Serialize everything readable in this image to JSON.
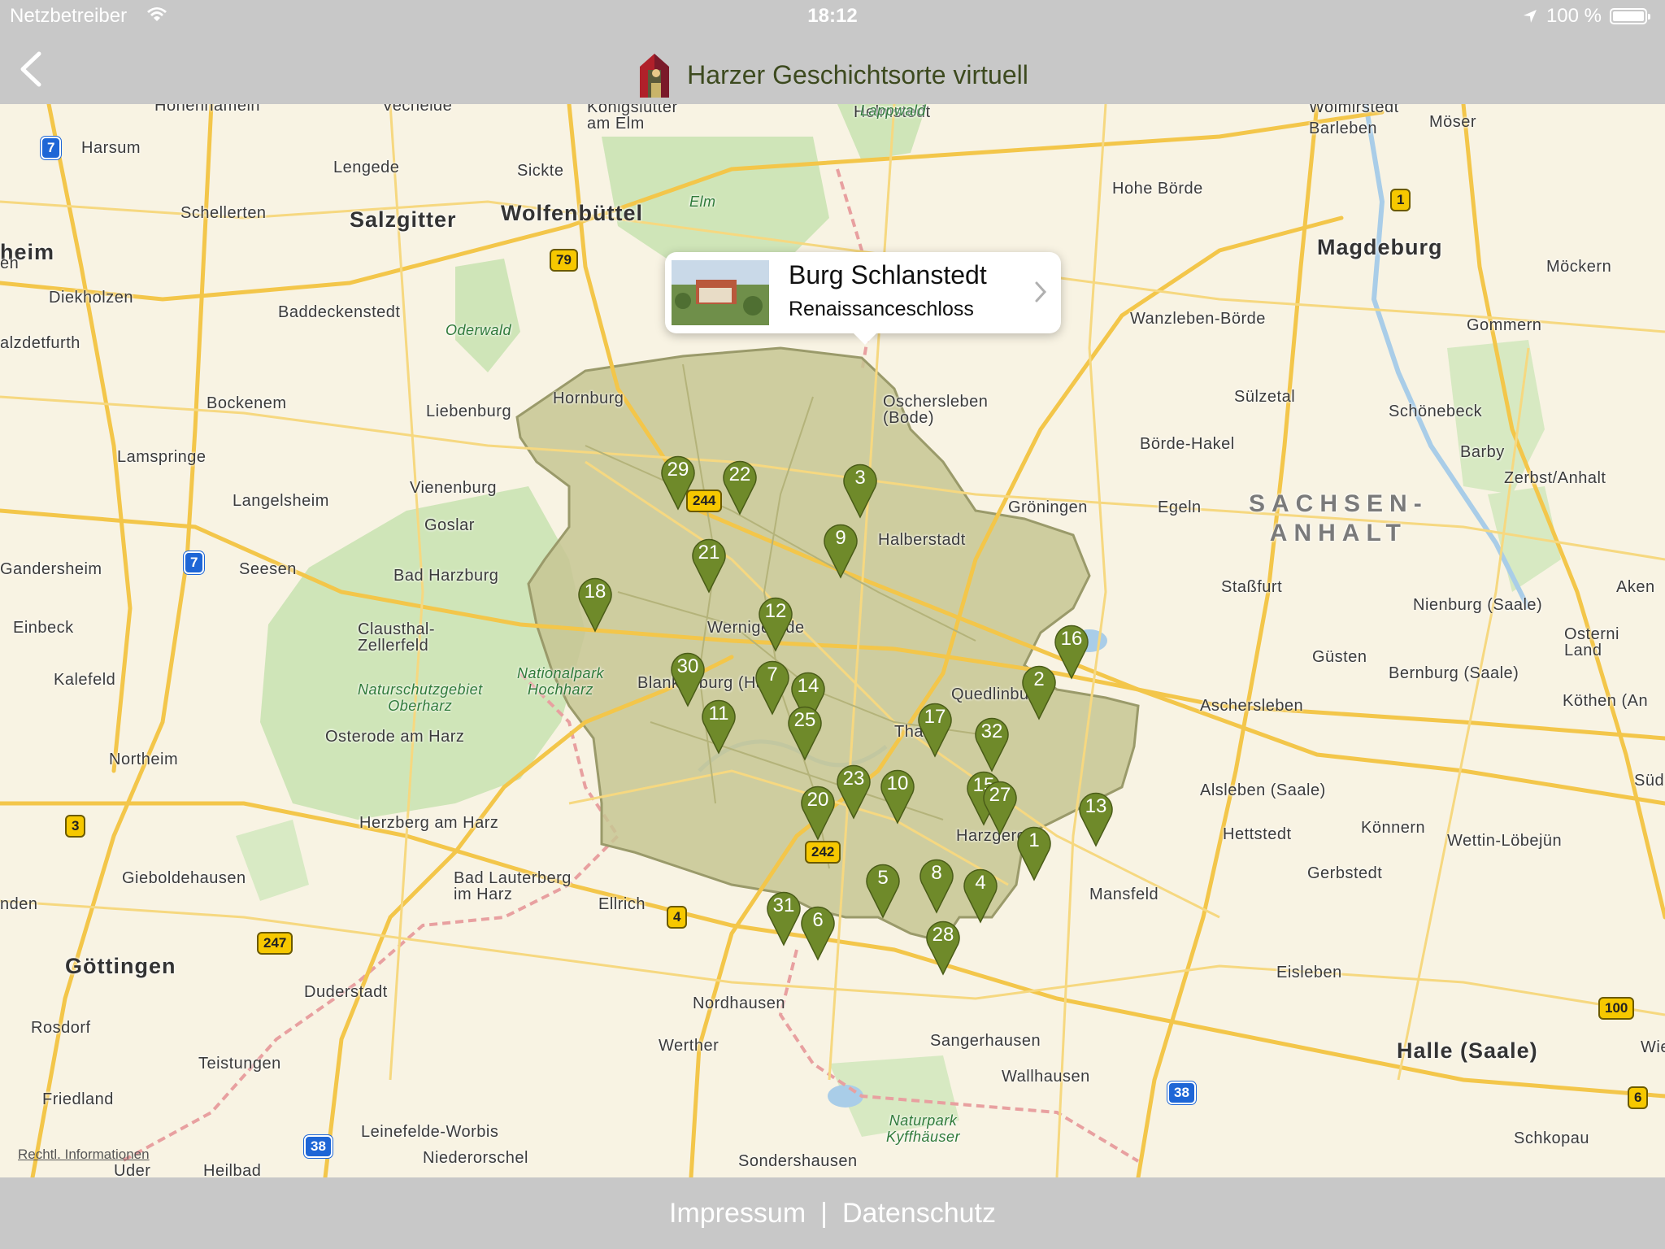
{
  "status": {
    "carrier": "Netzbetreiber",
    "time": "18:12",
    "battery": "100 %"
  },
  "nav": {
    "title": "Harzer Geschichtsorte virtuell",
    "back_icon": "chevron-left-icon"
  },
  "callout": {
    "title": "Burg Schlanstedt",
    "subtitle": "Renaissanceschloss"
  },
  "map": {
    "legal": "Rechtl. Informationen",
    "region": "SACHSEN-\nANHALT",
    "cities": [
      {
        "name": "Hohenhameln",
        "big": false
      },
      {
        "name": "Vechelde",
        "big": false
      },
      {
        "name": "Königslutter\nam Elm",
        "big": false
      },
      {
        "name": "Helmstedt",
        "big": false
      },
      {
        "name": "Wolmirstedt",
        "big": false
      },
      {
        "name": "Barleben",
        "big": false
      },
      {
        "name": "Möser",
        "big": false
      },
      {
        "name": "Harsum",
        "big": false
      },
      {
        "name": "Lengede",
        "big": false
      },
      {
        "name": "Sickte",
        "big": false
      },
      {
        "name": "Hohe Börde",
        "big": false
      },
      {
        "name": "Schellerten",
        "big": false
      },
      {
        "name": "Salzgitter",
        "big": true
      },
      {
        "name": "Wolfenbüttel",
        "big": true
      },
      {
        "name": "Magdeburg",
        "big": true
      },
      {
        "name": "heim",
        "big": true
      },
      {
        "name": "Diekholzen",
        "big": false
      },
      {
        "name": "Baddeckenstedt",
        "big": false
      },
      {
        "name": "Wanzleben-Börde",
        "big": false
      },
      {
        "name": "Möckern",
        "big": false
      },
      {
        "name": "alzdetfurth",
        "big": false
      },
      {
        "name": "Gommern",
        "big": false
      },
      {
        "name": "Hornburg",
        "big": false
      },
      {
        "name": "Bockenem",
        "big": false
      },
      {
        "name": "Liebenburg",
        "big": false
      },
      {
        "name": "Oschersleben\n(Bode)",
        "big": false
      },
      {
        "name": "Sülzetal",
        "big": false
      },
      {
        "name": "Schönebeck",
        "big": false
      },
      {
        "name": "Lamspringe",
        "big": false
      },
      {
        "name": "Börde-Hakel",
        "big": false
      },
      {
        "name": "Barby",
        "big": false
      },
      {
        "name": "Zerbst/Anhalt",
        "big": false
      },
      {
        "name": "Vienenburg",
        "big": false
      },
      {
        "name": "Langelsheim",
        "big": false
      },
      {
        "name": "Gröningen",
        "big": false
      },
      {
        "name": "Egeln",
        "big": false
      },
      {
        "name": "Goslar",
        "big": false
      },
      {
        "name": "Halberstadt",
        "big": false
      },
      {
        "name": "Gandersheim",
        "big": false
      },
      {
        "name": "Seesen",
        "big": false
      },
      {
        "name": "Bad Harzburg",
        "big": false
      },
      {
        "name": "Staßfurt",
        "big": false
      },
      {
        "name": "Aken",
        "big": false
      },
      {
        "name": "Einbeck",
        "big": false
      },
      {
        "name": "Clausthal-\nZellerfeld",
        "big": false
      },
      {
        "name": "Nienburg (Saale)",
        "big": false
      },
      {
        "name": "Osterni\nLand",
        "big": false
      },
      {
        "name": "Kalefeld",
        "big": false
      },
      {
        "name": "Güsten",
        "big": false
      },
      {
        "name": "Bernburg (Saale)",
        "big": false
      },
      {
        "name": "Blankenburg (Harz)",
        "big": false
      },
      {
        "name": "Quedlinburg",
        "big": false
      },
      {
        "name": "Köthen (An",
        "big": false
      },
      {
        "name": "Aschersleben",
        "big": false
      },
      {
        "name": "Osterode am Harz",
        "big": false
      },
      {
        "name": "Northeim",
        "big": false
      },
      {
        "name": "Thale",
        "big": false
      },
      {
        "name": "Alsleben (Saale)",
        "big": false
      },
      {
        "name": "Süd",
        "big": false
      },
      {
        "name": "Herzberg am Harz",
        "big": false
      },
      {
        "name": "Hettstedt",
        "big": false
      },
      {
        "name": "Könnern",
        "big": false
      },
      {
        "name": "Harzgerode",
        "big": false
      },
      {
        "name": "Wettin-Löbejün",
        "big": false
      },
      {
        "name": "Gieboldehausen",
        "big": false
      },
      {
        "name": "Bad Lauterberg\nim Harz",
        "big": false
      },
      {
        "name": "Gerbstedt",
        "big": false
      },
      {
        "name": "nden",
        "big": false
      },
      {
        "name": "Ellrich",
        "big": false
      },
      {
        "name": "Mansfeld",
        "big": false
      },
      {
        "name": "Göttingen",
        "big": true
      },
      {
        "name": "Eisleben",
        "big": false
      },
      {
        "name": "Duderstadt",
        "big": false
      },
      {
        "name": "Nordhausen",
        "big": false
      },
      {
        "name": "Rosdorf",
        "big": false
      },
      {
        "name": "Werther",
        "big": false
      },
      {
        "name": "Sangerhausen",
        "big": false
      },
      {
        "name": "Halle (Saale)",
        "big": true
      },
      {
        "name": "Wie",
        "big": false
      },
      {
        "name": "Teistungen",
        "big": false
      },
      {
        "name": "Wallhausen",
        "big": false
      },
      {
        "name": "Friedland",
        "big": false
      },
      {
        "name": "Leinefelde-Worbis",
        "big": false
      },
      {
        "name": "Schkopau",
        "big": false
      },
      {
        "name": "Niederorschel",
        "big": false
      },
      {
        "name": "Sondershausen",
        "big": false
      },
      {
        "name": "Uder",
        "big": false
      },
      {
        "name": "Heilbad",
        "big": false
      },
      {
        "name": "en",
        "big": false
      },
      {
        "name": "Wernigerode",
        "big": false
      }
    ],
    "parks": [
      "Lappwald",
      "Elm",
      "Oderwald",
      "Nationalpark\nHochharz",
      "Naturschutzgebiet\nOberharz",
      "Naturpark\nKyffhäuser"
    ],
    "road_shields": [
      {
        "text": "7",
        "type": "autobahn"
      },
      {
        "text": "79",
        "type": "federal"
      },
      {
        "text": "1",
        "type": "federal"
      },
      {
        "text": "244",
        "type": "federal"
      },
      {
        "text": "7",
        "type": "autobahn"
      },
      {
        "text": "3",
        "type": "federal"
      },
      {
        "text": "4",
        "type": "federal"
      },
      {
        "text": "247",
        "type": "federal"
      },
      {
        "text": "242",
        "type": "federal"
      },
      {
        "text": "38",
        "type": "autobahn"
      },
      {
        "text": "38",
        "type": "autobahn"
      },
      {
        "text": "100",
        "type": "federal"
      },
      {
        "text": "6",
        "type": "federal"
      }
    ],
    "pins": [
      "29",
      "22",
      "3",
      "9",
      "21",
      "18",
      "12",
      "16",
      "2",
      "30",
      "7",
      "14",
      "11",
      "25",
      "17",
      "32",
      "23",
      "10",
      "15",
      "27",
      "20",
      "13",
      "1",
      "5",
      "8",
      "4",
      "31",
      "6",
      "28"
    ]
  },
  "footer": {
    "impressum": "Impressum",
    "separator": "|",
    "datenschutz": "Datenschutz"
  },
  "colors": {
    "pin": "#6f8a2a",
    "region_fill": "#c5c590",
    "bars": "#c8c8c8"
  }
}
